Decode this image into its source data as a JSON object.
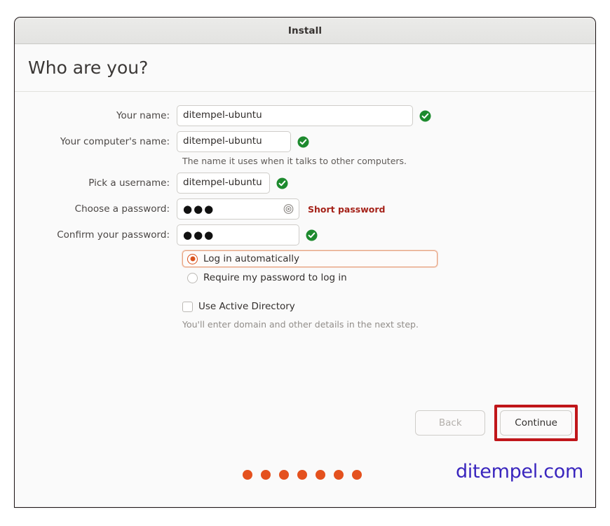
{
  "window": {
    "title": "Install"
  },
  "page": {
    "title": "Who are you?"
  },
  "form": {
    "fields": [
      {
        "label": "Your name:",
        "value": "ditempel-ubuntu",
        "status": "valid",
        "status_icon": "check-circle-icon"
      },
      {
        "label": "Your computer's name:",
        "value": "ditempel-ubuntu",
        "status": "valid",
        "status_icon": "check-circle-icon",
        "hint": "The name it uses when it talks to other computers."
      },
      {
        "label": "Pick a username:",
        "value": "ditempel-ubuntu",
        "status": "valid",
        "status_icon": "check-circle-icon"
      },
      {
        "label": "Choose a password:",
        "value": "●●●",
        "status": "warning",
        "status_text": "Short password",
        "reveal_icon": "eye-reveal-icon"
      },
      {
        "label": "Confirm your password:",
        "value": "●●●",
        "status": "valid",
        "status_icon": "check-circle-icon"
      }
    ],
    "login_options": [
      {
        "label": "Log in automatically",
        "selected": true,
        "focused": true
      },
      {
        "label": "Require my password to log in",
        "selected": false,
        "focused": false
      }
    ],
    "active_directory": {
      "label": "Use Active Directory",
      "checked": false,
      "hint": "You'll enter domain and other details in the next step."
    }
  },
  "buttons": {
    "back": "Back",
    "continue": "Continue"
  },
  "footer": {
    "progress_dots": 7,
    "watermark": "ditempel.com"
  },
  "colors": {
    "accent_orange": "#e4511e",
    "valid_green": "#1d8a2e",
    "error_red": "#a52219",
    "highlight_red": "#c0161a",
    "watermark_blue": "#3a26be"
  }
}
